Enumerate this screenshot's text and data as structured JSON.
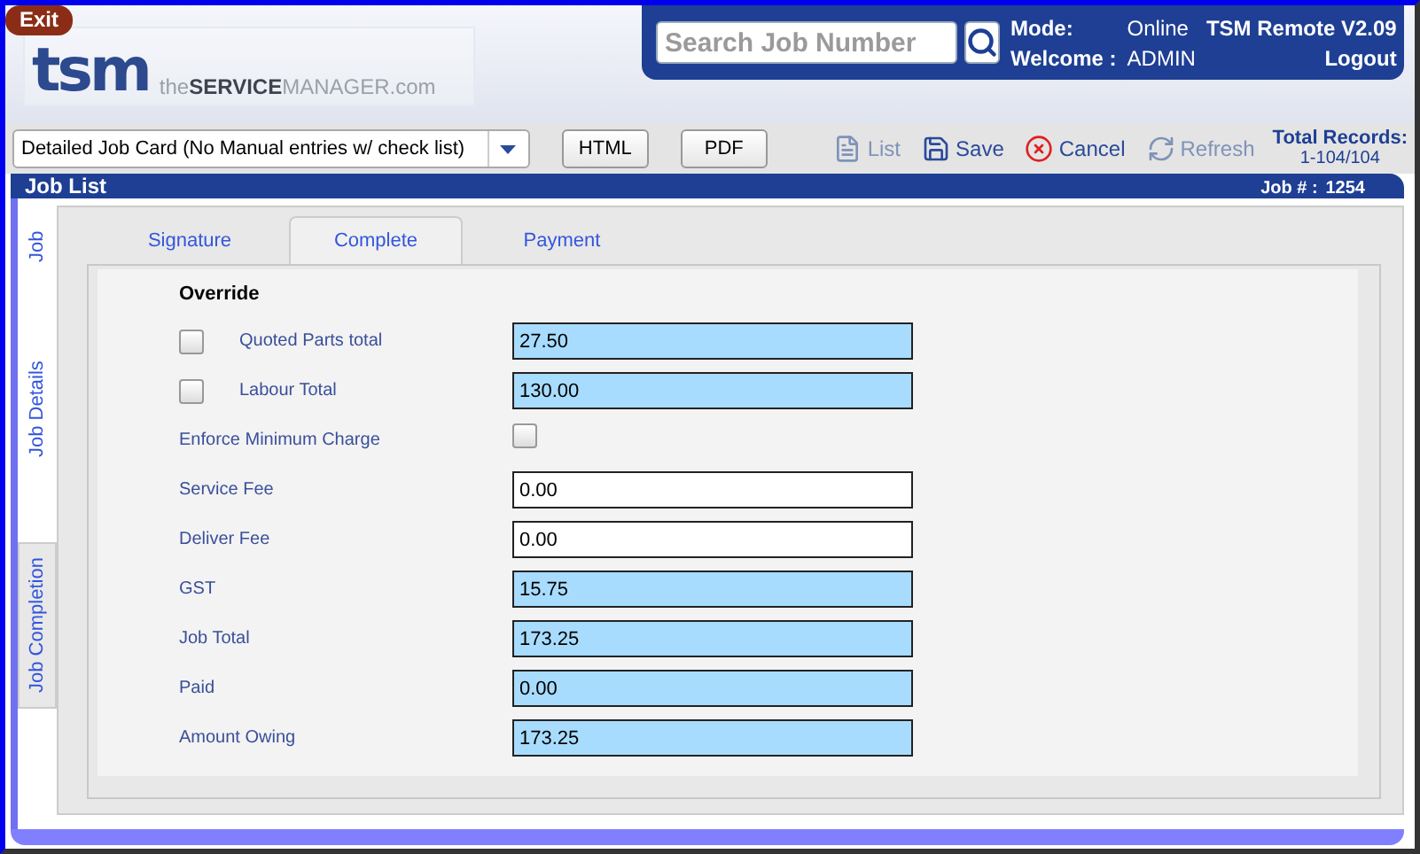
{
  "exit_button": "Exit",
  "logo": {
    "mark": "tsm",
    "tagline": "the**SERVICE**MANAGER.com"
  },
  "header": {
    "search": {
      "placeholder": "Search Job Number"
    },
    "mode_label": "Mode:",
    "mode_value": "Online",
    "app_name": "TSM Remote V2.09",
    "welcome_label": "Welcome :",
    "user": "ADMIN",
    "logout": "Logout"
  },
  "toolbar": {
    "report_select": "Detailed Job Card (No Manual entries w/ check list)",
    "buttons": [
      "HTML",
      "PDF"
    ],
    "actions": [
      {
        "kind": "list",
        "label": "List",
        "disabled": true
      },
      {
        "kind": "save",
        "label": "Save",
        "disabled": false
      },
      {
        "kind": "cancel",
        "label": "Cancel",
        "disabled": false
      },
      {
        "kind": "refresh",
        "label": "Refresh",
        "disabled": true
      }
    ],
    "total_records_label": "Total Records:",
    "total_records_value": "1-104/104"
  },
  "section": {
    "title": "Job List",
    "job_label": "Job # :",
    "job_number": "1254"
  },
  "side_tabs": [
    {
      "label": "Job",
      "selected": false
    },
    {
      "label": "Job Details",
      "selected": false
    },
    {
      "label": "Job Completion",
      "selected": true
    }
  ],
  "tabs": [
    {
      "label": "Signature",
      "selected": false
    },
    {
      "label": "Complete",
      "selected": true
    },
    {
      "label": "Payment",
      "selected": false
    }
  ],
  "form": {
    "heading": "Override",
    "rows": [
      {
        "kind": "override",
        "label": "Quoted Parts total",
        "checked": false,
        "value": "27.50",
        "highlighted": true
      },
      {
        "kind": "override",
        "label": "Labour Total",
        "checked": false,
        "value": "130.00",
        "highlighted": true
      },
      {
        "kind": "checkbox",
        "label": "Enforce Minimum Charge",
        "checked": false
      },
      {
        "kind": "field",
        "label": "Service Fee",
        "value": "0.00",
        "highlighted": false
      },
      {
        "kind": "field",
        "label": "Deliver Fee",
        "value": "0.00",
        "highlighted": false
      },
      {
        "kind": "field",
        "label": "GST",
        "value": "15.75",
        "highlighted": true
      },
      {
        "kind": "field",
        "label": "Job Total",
        "value": "173.25",
        "highlighted": true
      },
      {
        "kind": "field",
        "label": "Paid",
        "value": "0.00",
        "highlighted": true
      },
      {
        "kind": "field",
        "label": "Amount Owing",
        "value": "173.25",
        "highlighted": true
      }
    ]
  }
}
